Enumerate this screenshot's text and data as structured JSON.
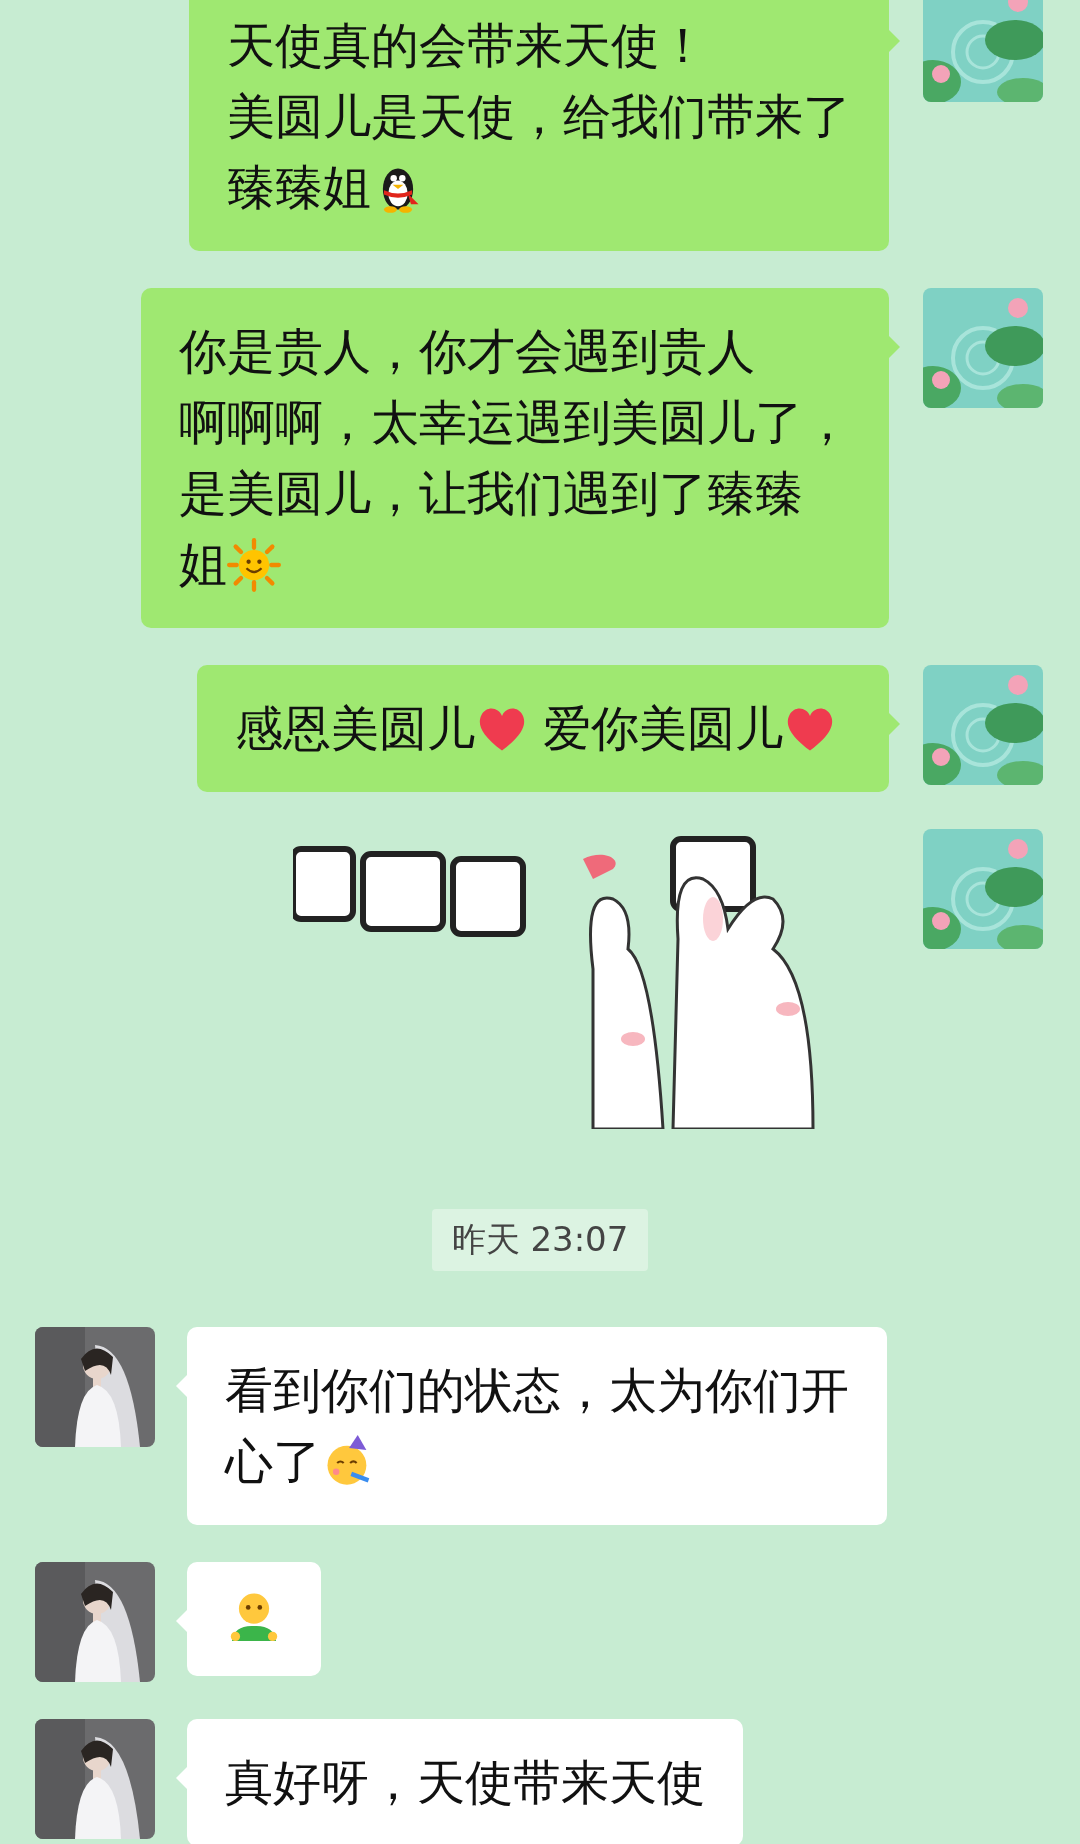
{
  "messages": [
    {
      "kind": "sent",
      "lines": [
        [
          {
            "kind": "text",
            "text": "天使真的会带来天使！"
          }
        ],
        [
          {
            "kind": "text",
            "text": "美圆儿是天使，给我们带来了"
          }
        ],
        [
          {
            "kind": "text",
            "text": "臻臻姐"
          },
          {
            "kind": "penguin"
          }
        ]
      ]
    },
    {
      "kind": "sent",
      "lines": [
        [
          {
            "kind": "text",
            "text": "你是贵人，你才会遇到贵人"
          }
        ],
        [
          {
            "kind": "text",
            "text": "啊啊啊，太幸运遇到美圆儿了，"
          }
        ],
        [
          {
            "kind": "text",
            "text": "是美圆儿，让我们遇到了臻臻"
          }
        ],
        [
          {
            "kind": "text",
            "text": "姐"
          },
          {
            "kind": "sun"
          }
        ]
      ]
    },
    {
      "kind": "sent",
      "lines": [
        [
          {
            "kind": "text",
            "text": "感恩美圆儿"
          },
          {
            "kind": "heart"
          },
          {
            "kind": "text",
            "text": "爱你美圆儿"
          },
          {
            "kind": "heart"
          }
        ]
      ]
    },
    {
      "kind": "sent_sticker"
    },
    {
      "kind": "time",
      "text": "昨天 23:07"
    },
    {
      "kind": "received",
      "lines": [
        [
          {
            "kind": "text",
            "text": "看到你们的状态，太为你们开"
          }
        ],
        [
          {
            "kind": "text",
            "text": "心了"
          },
          {
            "kind": "party"
          }
        ]
      ]
    },
    {
      "kind": "received",
      "lines": [
        [
          {
            "kind": "figure"
          }
        ]
      ]
    },
    {
      "kind": "received",
      "lines": [
        [
          {
            "kind": "text",
            "text": "真好呀，天使带来天使"
          }
        ]
      ]
    }
  ]
}
